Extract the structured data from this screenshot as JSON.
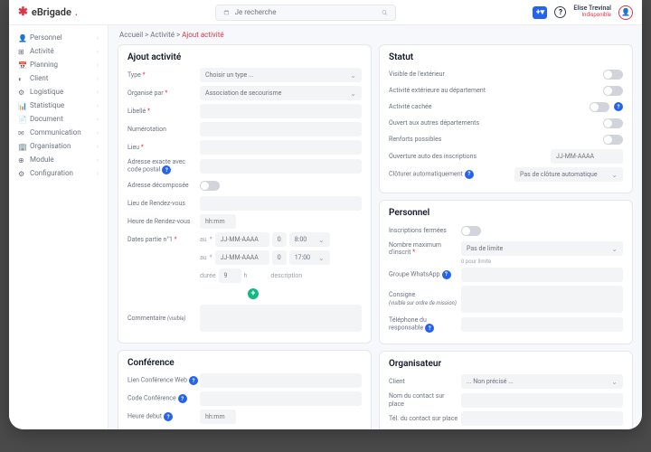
{
  "brand": "eBrigade",
  "search_placeholder": "Je recherche",
  "user": {
    "name": "Elise Trevinal",
    "status": "Indisponible"
  },
  "sidebar": [
    {
      "label": "Personnel"
    },
    {
      "label": "Activité"
    },
    {
      "label": "Planning"
    },
    {
      "label": "Client"
    },
    {
      "label": "Logistique"
    },
    {
      "label": "Statistique"
    },
    {
      "label": "Document"
    },
    {
      "label": "Communication"
    },
    {
      "label": "Organisation"
    },
    {
      "label": "Module"
    },
    {
      "label": "Configuration"
    }
  ],
  "crumbs": {
    "home": "Accueil",
    "sep": ">",
    "p1": "Activité",
    "p2": "Ajout activité"
  },
  "cards": {
    "ajout": {
      "title": "Ajout activité",
      "type": {
        "label": "Type",
        "placeholder": "Choisir un type ..."
      },
      "organise": {
        "label": "Organisé par",
        "value": "Association de secourisme"
      },
      "libelle": {
        "label": "Libellé"
      },
      "numerotation": {
        "label": "Numérotation"
      },
      "lieu": {
        "label": "Lieu"
      },
      "adresse_cp": {
        "label": "Adresse exacte avec code postal"
      },
      "adresse_dec": {
        "label": "Adresse décomposée"
      },
      "lieu_rdv": {
        "label": "Lieu de Rendez-vous"
      },
      "heure_rdv": {
        "label": "Heure de Rendez-vous",
        "placeholder": "hh:mm"
      },
      "dates": {
        "label": "Dates partie n°1",
        "au": "au",
        "date_ph": "JJ-MM-AAAA",
        "zero": "0",
        "t1": "8:00",
        "t2": "17:00"
      },
      "duree": {
        "label": "durée",
        "val": "9",
        "unit": "h",
        "desc": "description"
      },
      "commentaire": {
        "label": "Commentaire",
        "note": "(visible)"
      }
    },
    "conference": {
      "title": "Conférence",
      "lien": {
        "label": "Lien Conférence Web"
      },
      "code": {
        "label": "Code Conférence"
      },
      "heure": {
        "label": "Heure debut",
        "placeholder": "hh:mm"
      }
    },
    "statut": {
      "title": "Statut",
      "items": [
        "Visible de l'extérieur",
        "Activité extérieure au département",
        "Activité cachée",
        "Ouvert aux autres départements",
        "Renforts possibles",
        "Ouverture auto des inscriptions"
      ],
      "ouv_date": "JJ-MM-AAAA",
      "cloture": {
        "label": "Clôturer automatiquement",
        "value": "Pas de clôture automatique"
      }
    },
    "personnel": {
      "title": "Personnel",
      "insc": {
        "label": "Inscriptions fermées"
      },
      "max": {
        "label": "Nombre maximum d'inscrit",
        "note": "0 pour limite",
        "value": "Pas de limite"
      },
      "whatsapp": {
        "label": "Groupe WhatsApp"
      },
      "consigne": {
        "label": "Consigne",
        "note": "(visible sur ordre de mission)"
      },
      "tel": {
        "label": "Téléphone du responsable"
      }
    },
    "organisateur": {
      "title": "Organisateur",
      "client": {
        "label": "Client",
        "value": "... Non précisé ..."
      },
      "nom": {
        "label": "Nom du contact sur place"
      },
      "tel": {
        "label": "Tél. du contact sur place"
      }
    }
  }
}
